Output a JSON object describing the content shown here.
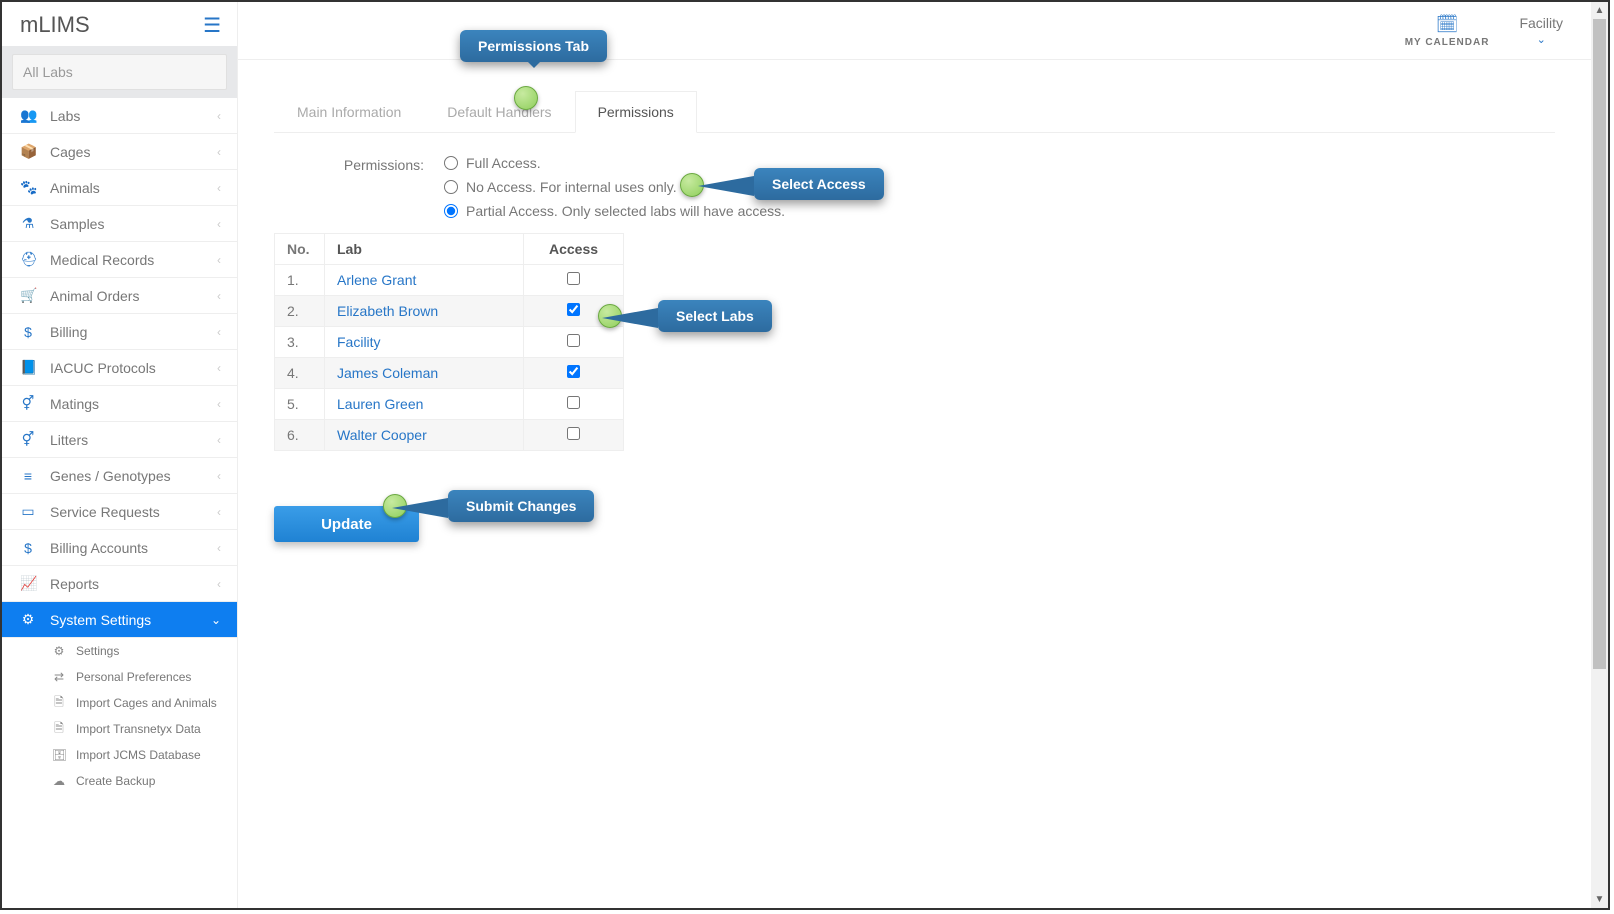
{
  "brand": "mLIMS",
  "search": {
    "placeholder": "All Labs"
  },
  "topbar": {
    "calendar_label": "MY CALENDAR",
    "facility_label": "Facility"
  },
  "nav": {
    "items": [
      {
        "icon": "👥",
        "label": "Labs"
      },
      {
        "icon": "📦",
        "label": "Cages"
      },
      {
        "icon": "🐾",
        "label": "Animals"
      },
      {
        "icon": "⚗",
        "label": "Samples"
      },
      {
        "icon": "⛑",
        "label": "Medical Records"
      },
      {
        "icon": "🛒",
        "label": "Animal Orders"
      },
      {
        "icon": "$",
        "label": "Billing"
      },
      {
        "icon": "📘",
        "label": "IACUC Protocols"
      },
      {
        "icon": "⚥",
        "label": "Matings"
      },
      {
        "icon": "⚥",
        "label": "Litters"
      },
      {
        "icon": "≡",
        "label": "Genes / Genotypes"
      },
      {
        "icon": "▭",
        "label": "Service Requests"
      },
      {
        "icon": "$",
        "label": "Billing Accounts"
      },
      {
        "icon": "📈",
        "label": "Reports"
      },
      {
        "icon": "⚙",
        "label": "System Settings"
      }
    ],
    "sub": [
      {
        "icon": "⚙",
        "label": "Settings"
      },
      {
        "icon": "⇄",
        "label": "Personal Preferences"
      },
      {
        "icon": "🗎",
        "label": "Import Cages and Animals"
      },
      {
        "icon": "🗎",
        "label": "Import Transnetyx Data"
      },
      {
        "icon": "🗄",
        "label": "Import JCMS Database"
      },
      {
        "icon": "☁",
        "label": "Create Backup"
      }
    ]
  },
  "tabs": {
    "items": [
      "Main Information",
      "Default Handlers",
      "Permissions"
    ],
    "active_index": 2
  },
  "form": {
    "label": "Permissions:",
    "options": [
      "Full Access.",
      "No Access. For internal uses only.",
      "Partial Access. Only selected labs will have access."
    ],
    "selected_index": 2
  },
  "table": {
    "headers": [
      "No.",
      "Lab",
      "Access"
    ],
    "rows": [
      {
        "no": "1.",
        "lab": "Arlene Grant",
        "checked": false
      },
      {
        "no": "2.",
        "lab": "Elizabeth Brown",
        "checked": true
      },
      {
        "no": "3.",
        "lab": "Facility",
        "checked": false
      },
      {
        "no": "4.",
        "lab": "James Coleman",
        "checked": true
      },
      {
        "no": "5.",
        "lab": "Lauren Green",
        "checked": false
      },
      {
        "no": "6.",
        "lab": "Walter Cooper",
        "checked": false
      }
    ]
  },
  "buttons": {
    "update": "Update"
  },
  "callouts": {
    "permissions_tab": "Permissions Tab",
    "select_access": "Select Access",
    "select_labs": "Select Labs",
    "submit_changes": "Submit Changes"
  }
}
